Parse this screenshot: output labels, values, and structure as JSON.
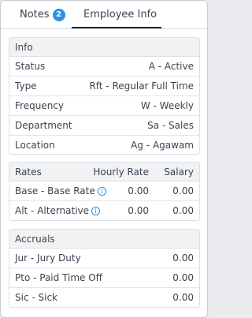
{
  "tabs": {
    "notes_label": "Notes",
    "notes_count": "2",
    "employee_info_label": "Employee Info"
  },
  "info": {
    "title": "Info",
    "rows": [
      {
        "label": "Status",
        "value": "A - Active"
      },
      {
        "label": "Type",
        "value": "Rft - Regular Full Time"
      },
      {
        "label": "Frequency",
        "value": "W - Weekly"
      },
      {
        "label": "Department",
        "value": "Sa - Sales"
      },
      {
        "label": "Location",
        "value": "Ag - Agawam"
      }
    ]
  },
  "rates": {
    "title": "Rates",
    "col_hourly": "Hourly Rate",
    "col_salary": "Salary",
    "rows": [
      {
        "label": "Base - Base Rate",
        "hourly": "0.00",
        "salary": "0.00",
        "icon": "info-icon"
      },
      {
        "label": "Alt - Alternative",
        "hourly": "0.00",
        "salary": "0.00",
        "icon": "info-icon"
      }
    ]
  },
  "accruals": {
    "title": "Accruals",
    "rows": [
      {
        "label": "Jur - Jury Duty",
        "value": "0.00"
      },
      {
        "label": "Pto - Paid Time Off",
        "value": "0.00"
      },
      {
        "label": "Sic - Sick",
        "value": "0.00"
      }
    ]
  },
  "colors": {
    "accent": "#2f8fe0",
    "tab_underline": "#1f2530",
    "section_header_bg": "#f1f2f4"
  }
}
